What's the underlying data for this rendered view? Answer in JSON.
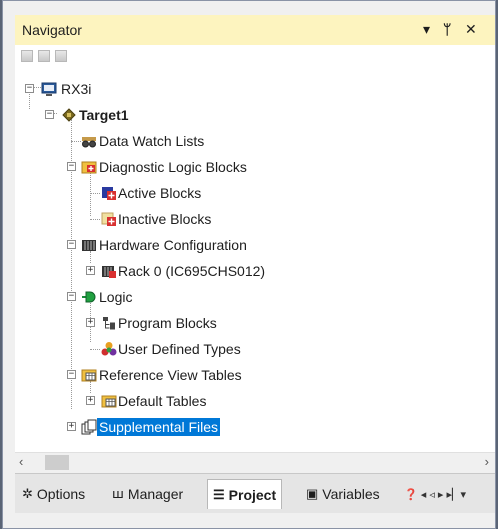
{
  "navigator": {
    "title": "Navigator",
    "buttons": {
      "dropdown": "▾",
      "pin": "ᛘ",
      "close": "✕"
    }
  },
  "tree": [
    {
      "label": "RX3i",
      "icon": "monitor-icon"
    },
    {
      "label": "Target1",
      "icon": "target-icon"
    },
    {
      "label": "Data Watch Lists",
      "icon": "watch-glasses-icon"
    },
    {
      "label": "Diagnostic Logic Blocks",
      "icon": "diagnostic-block-icon"
    },
    {
      "label": "Active Blocks",
      "icon": "active-block-icon"
    },
    {
      "label": "Inactive Blocks",
      "icon": "inactive-block-icon"
    },
    {
      "label": "Hardware Configuration",
      "icon": "hardware-icon"
    },
    {
      "label": "Rack 0 (IC695CHS012)",
      "icon": "rack-icon"
    },
    {
      "label": "Logic",
      "icon": "logic-icon"
    },
    {
      "label": "Program Blocks",
      "icon": "program-blocks-icon"
    },
    {
      "label": "User Defined Types",
      "icon": "user-types-icon"
    },
    {
      "label": "Reference View Tables",
      "icon": "reference-table-icon"
    },
    {
      "label": "Default Tables",
      "icon": "default-table-icon"
    },
    {
      "label": "Supplemental Files",
      "icon": "supplemental-files-icon"
    }
  ],
  "scrollbar": {
    "left": "‹",
    "right": "›"
  },
  "tabs": [
    {
      "label": "Options",
      "icon": "gear-icon",
      "glyph": "✲"
    },
    {
      "label": "Manager",
      "icon": "manager-icon",
      "glyph": "ꟺ"
    },
    {
      "label": "Project",
      "icon": "project-icon",
      "glyph": "☰"
    },
    {
      "label": "Variables",
      "icon": "variables-icon",
      "glyph": "▣"
    }
  ],
  "tab_overflow": {
    "glyph": "❓ ◂ ◃ ▸ ▸▏▾"
  },
  "colors": {
    "selection": "#0078d7",
    "title_bg": "#fdf4bf",
    "frame": "#5a6476"
  }
}
